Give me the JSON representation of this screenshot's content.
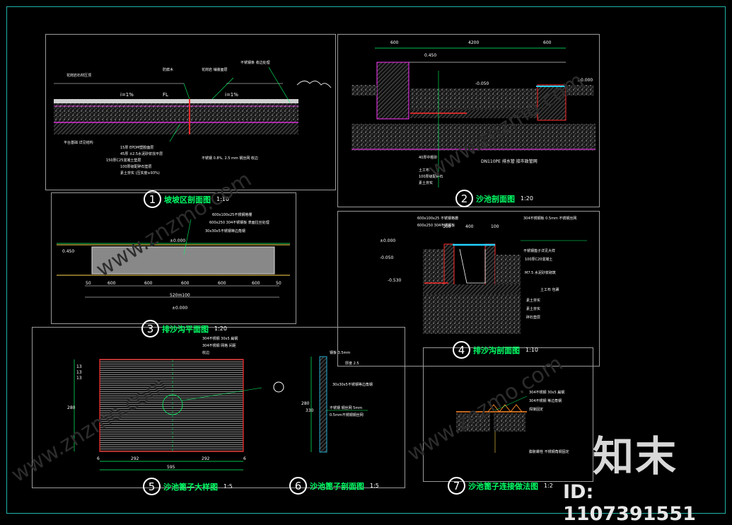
{
  "sheet": {
    "border_color": "#1fb3a8",
    "line_color": "#00ff66",
    "dim_color": "#ffffff",
    "accent_magenta": "#ff33ff",
    "accent_red": "#ff2a2a",
    "accent_cyan": "#22d3ff"
  },
  "drawings": [
    {
      "num": "1",
      "title": "坡坡区剖面图",
      "scale": "1:10"
    },
    {
      "num": "2",
      "title": "沙池剖面图",
      "scale": "1:20"
    },
    {
      "num": "3",
      "title": "排沙沟平面图",
      "scale": "1:20"
    },
    {
      "num": "4",
      "title": "排沙沟剖面图",
      "scale": "1:10"
    },
    {
      "num": "5",
      "title": "沙池篦子大样图",
      "scale": "1:5"
    },
    {
      "num": "6",
      "title": "沙池篦子剖面图",
      "scale": "1:5"
    },
    {
      "num": "7",
      "title": "沙池篦子连接做法图",
      "scale": "1:2"
    }
  ],
  "dims": {
    "d2_top": [
      "600",
      "4200",
      "600"
    ],
    "d2_levels": [
      "0.450",
      "-0.050",
      "±0.000"
    ],
    "d3_bottom": [
      "50",
      "600",
      "600",
      "600",
      "600",
      "600",
      "50"
    ],
    "d3_total": "520m100",
    "d3_levels": [
      "0.450",
      "±0.000",
      "±0.000"
    ],
    "d4_top": [
      "100",
      "400",
      "100"
    ],
    "d4_levels": [
      "±0.000",
      "-0.050",
      "-0.530"
    ],
    "d5_bottom": [
      "6",
      "292",
      "292",
      "6"
    ],
    "d5_total": "595",
    "d5_left": [
      "13",
      "13",
      "13"
    ],
    "d5_side": "280",
    "d6_side": [
      "280",
      "330"
    ],
    "d1_slope": [
      "i=1%",
      "i=1%"
    ],
    "d1_fl": "FL"
  },
  "labels": {
    "d1_notes": [
      "15厚 EPDM塑胶面层",
      "45厚 ±2.5水泥砂浆找平层",
      "150厚C25混凝土垫层",
      "100厚级配碎石垫层",
      "素土夯实 (压实度≥93%)"
    ],
    "d2_notes": [
      "40厚中粗砂",
      "土工布",
      "100厚级配碎石",
      "素土夯实"
    ],
    "d2_pipe": "DN110PE 排水管 接市政管网",
    "d4_notes": [
      "不锈钢篦子详见大样",
      "100厚C20混凝土",
      "M7.5 水泥砂浆砌筑",
      "素土夯实",
      "素土夯实",
      "碎石垫层"
    ],
    "d6_notes": [
      "30x30x5不锈钢等边角钢",
      "0.5mm不锈钢钢丝网"
    ]
  },
  "stamp": {
    "logo": "知末",
    "id": "ID: 1107391551"
  },
  "watermark": "www.znzmo.com"
}
